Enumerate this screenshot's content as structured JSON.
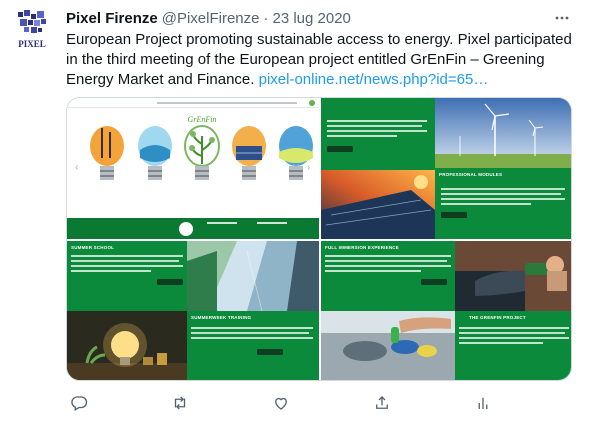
{
  "account": {
    "name": "Pixel Firenze",
    "handle": "@PixelFirenze",
    "separator": "·",
    "date": "23 lug 2020",
    "avatar_text": "PIXEL"
  },
  "tweet": {
    "text": "European Project promoting sustainable access to energy. Pixel participated in the third meeting of the European project entitled GrEnFin – Greening Energy Market and Finance.",
    "link": "pixel-online.net/news.php?id=65…"
  },
  "media": {
    "q1": {
      "logo_text": "GrEnFin"
    },
    "q2": {
      "heading": "PROFESSIONAL MODULES"
    },
    "q3": {
      "heading_top": "SUMMER SCHOOL",
      "heading_mid": "SUMMERWEEK TRAINING"
    },
    "q4": {
      "heading_top": "FULL IMMERSION EXPERIENCE",
      "heading_mid": "THE GRENFIN PROJECT"
    }
  },
  "actions": [
    {
      "name": "reply-icon"
    },
    {
      "name": "retweet-icon"
    },
    {
      "name": "like-icon"
    },
    {
      "name": "share-icon"
    },
    {
      "name": "analytics-icon"
    }
  ],
  "colors": {
    "green": "#0a8a3a",
    "link": "#1d9bf0",
    "muted": "#536471"
  }
}
